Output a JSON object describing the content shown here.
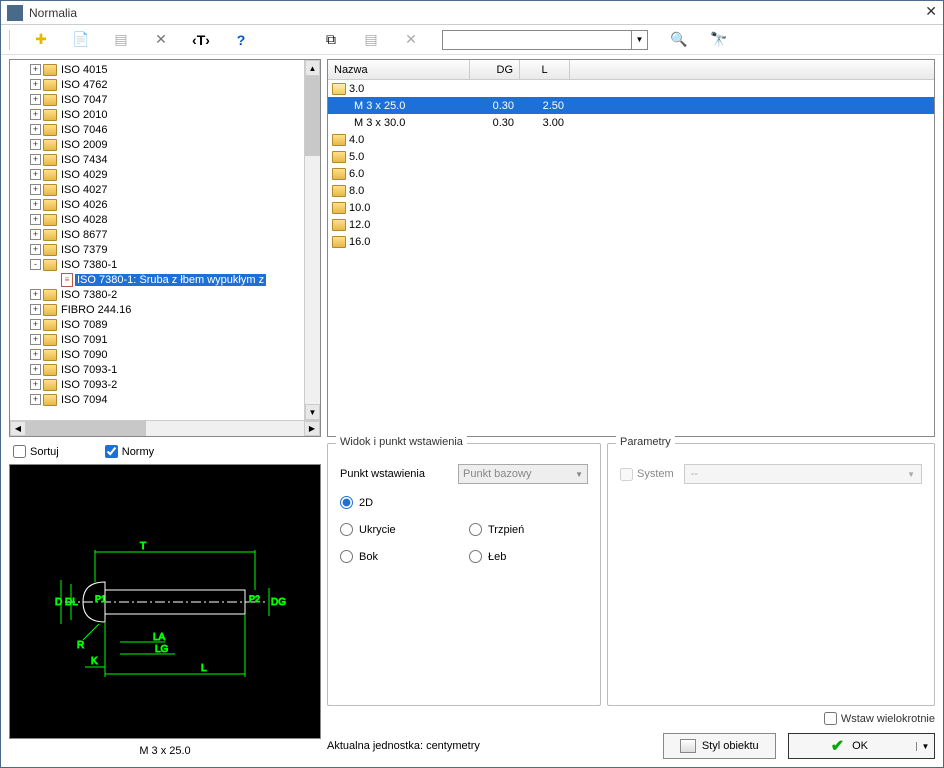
{
  "window": {
    "title": "Normalia"
  },
  "toolbar": {
    "icons": [
      "plus",
      "doc",
      "list",
      "tools",
      "tag",
      "help",
      "copy",
      "list2",
      "delete"
    ],
    "search": {
      "value": "",
      "placeholder": ""
    }
  },
  "tree": {
    "items": [
      {
        "exp": "+",
        "label": "ISO 4015"
      },
      {
        "exp": "+",
        "label": "ISO 4762"
      },
      {
        "exp": "+",
        "label": "ISO 7047"
      },
      {
        "exp": "+",
        "label": "ISO 2010"
      },
      {
        "exp": "+",
        "label": "ISO 7046"
      },
      {
        "exp": "+",
        "label": "ISO 2009"
      },
      {
        "exp": "+",
        "label": "ISO 7434"
      },
      {
        "exp": "+",
        "label": "ISO 4029"
      },
      {
        "exp": "+",
        "label": "ISO 4027"
      },
      {
        "exp": "+",
        "label": "ISO 4026"
      },
      {
        "exp": "+",
        "label": "ISO 4028"
      },
      {
        "exp": "+",
        "label": "ISO 8677"
      },
      {
        "exp": "+",
        "label": "ISO 7379"
      },
      {
        "exp": "-",
        "label": "ISO 7380-1",
        "children": [
          {
            "type": "doc",
            "label": "ISO 7380-1: Śruba z łbem wypukłym z",
            "selected": true
          }
        ]
      },
      {
        "exp": "+",
        "label": "ISO 7380-2"
      },
      {
        "exp": "+",
        "label": "FIBRO 244.16"
      },
      {
        "exp": "+",
        "label": "ISO 7089"
      },
      {
        "exp": "+",
        "label": "ISO 7091"
      },
      {
        "exp": "+",
        "label": "ISO 7090"
      },
      {
        "exp": "+",
        "label": "ISO 7093-1"
      },
      {
        "exp": "+",
        "label": "ISO 7093-2"
      },
      {
        "exp": "+",
        "label": "ISO 7094"
      }
    ]
  },
  "list": {
    "headers": {
      "name": "Nazwa",
      "dg": "DG",
      "l": "L"
    },
    "rows": [
      {
        "type": "folder",
        "name": "3.0",
        "indent": 0,
        "open": true
      },
      {
        "type": "item",
        "name": "M 3 x 25.0",
        "dg": "0.30",
        "l": "2.50",
        "indent": 1,
        "selected": true
      },
      {
        "type": "item",
        "name": "M 3 x 30.0",
        "dg": "0.30",
        "l": "3.00",
        "indent": 1
      },
      {
        "type": "folder",
        "name": "4.0",
        "indent": 0
      },
      {
        "type": "folder",
        "name": "5.0",
        "indent": 0
      },
      {
        "type": "folder",
        "name": "6.0",
        "indent": 0
      },
      {
        "type": "folder",
        "name": "8.0",
        "indent": 0
      },
      {
        "type": "folder",
        "name": "10.0",
        "indent": 0
      },
      {
        "type": "folder",
        "name": "12.0",
        "indent": 0
      },
      {
        "type": "folder",
        "name": "16.0",
        "indent": 0
      }
    ]
  },
  "checks": {
    "sort": "Sortuj",
    "norms": "Normy",
    "sort_checked": false,
    "norms_checked": true
  },
  "preview": {
    "caption": "M 3 x 25.0"
  },
  "widok": {
    "title": "Widok i punkt wstawienia",
    "punkt_label": "Punkt wstawienia",
    "punkt_value": "Punkt bazowy",
    "radios": {
      "r2d": "2D",
      "ukrycie": "Ukrycie",
      "trzpien": "Trzpień",
      "bok": "Bok",
      "leb": "Łeb"
    },
    "selected": "r2d"
  },
  "params": {
    "title": "Parametry",
    "system": "System",
    "value": "--"
  },
  "bottom": {
    "wstaw": "Wstaw wielokrotnie",
    "unit": "Aktualna jednostka: centymetry",
    "style": "Styl obiektu",
    "ok": "OK"
  }
}
